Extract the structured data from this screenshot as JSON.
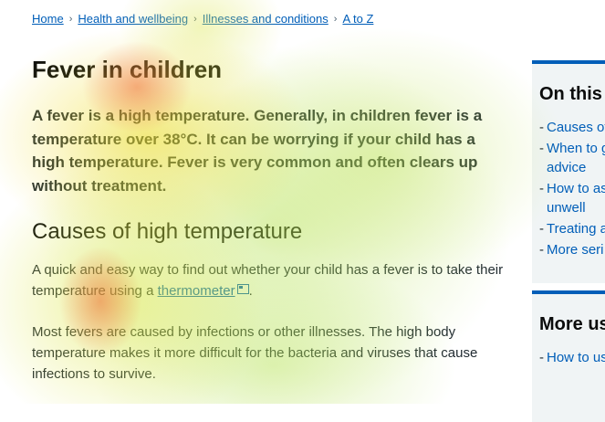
{
  "breadcrumb": [
    {
      "label": "Home"
    },
    {
      "label": "Health and wellbeing"
    },
    {
      "label": "Illnesses and conditions"
    },
    {
      "label": "A to Z"
    }
  ],
  "page": {
    "title": "Fever in children",
    "lead": "A fever is a high temperature. Generally, in children fever is a temperature over 38°C. It can be worrying if your child has a high temperature. Fever is very common and often clears up without treatment."
  },
  "section": {
    "heading": "Causes of high temperature",
    "p1_text": "A quick and easy way to find out whether your child has a fever is to take their temperature using a ",
    "p1_link": "thermometer",
    "p1_end": ".",
    "p2": "Most fevers are caused by infections or other illnesses. The high body temperature makes it more difficult for the bacteria and viruses that cause infections to survive."
  },
  "on_this_page": {
    "title": "On this p",
    "items": [
      {
        "label": "Causes of"
      },
      {
        "label": "When to g\nadvice"
      },
      {
        "label": "How to as\nunwell"
      },
      {
        "label": "Treating a"
      },
      {
        "label": "More seri"
      }
    ]
  },
  "more_useful": {
    "title": "More us",
    "items": [
      {
        "label": "How to us"
      }
    ]
  }
}
